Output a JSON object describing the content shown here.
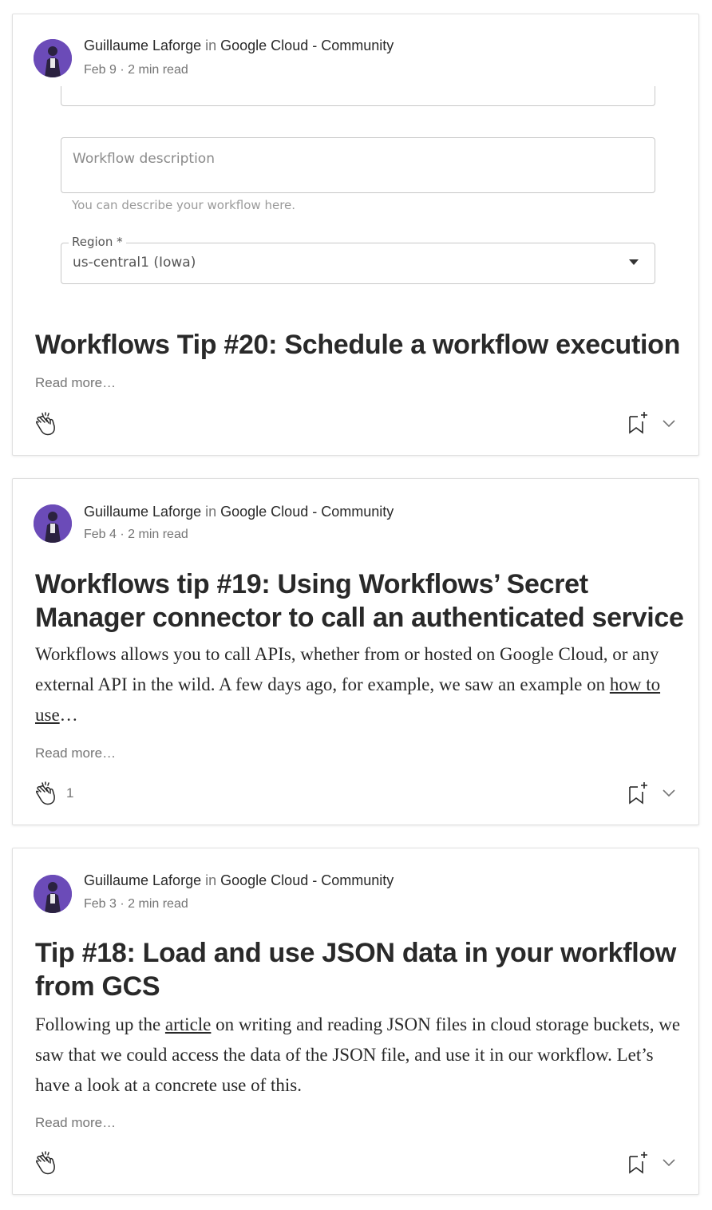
{
  "posts": [
    {
      "author": "Guillaume Laforge",
      "in_word": "in",
      "publication": "Google Cloud - Community",
      "date": "Feb 9",
      "read_time": "2 min read",
      "title": "Workflows Tip #20: Schedule a workflow execution",
      "excerpt": "",
      "read_more": "Read more…",
      "claps": "",
      "image": {
        "description_placeholder": "Workflow description",
        "description_helper": "You can describe your workflow here.",
        "region_label": "Region *",
        "region_value": "us-central1 (Iowa)"
      }
    },
    {
      "author": "Guillaume Laforge",
      "in_word": "in",
      "publication": "Google Cloud - Community",
      "date": "Feb 4",
      "read_time": "2 min read",
      "title": "Workflows tip #19: Using Workflows’ Secret Manager connector to call an authenticated service",
      "excerpt_before": "Workflows allows you to call APIs, whether from or hosted on Google Cloud, or any external API in the wild. A few days ago, for example, we saw an example on ",
      "excerpt_link": "how to use",
      "excerpt_after": "…",
      "read_more": "Read more…",
      "claps": "1"
    },
    {
      "author": "Guillaume Laforge",
      "in_word": "in",
      "publication": "Google Cloud - Community",
      "date": "Feb 3",
      "read_time": "2 min read",
      "title": "Tip #18: Load and use JSON data in your workflow from GCS",
      "excerpt_before": "Following up the ",
      "excerpt_link": "article",
      "excerpt_after": " on writing and reading JSON files in cloud storage buckets, we saw that we could access the data of the JSON file, and use it in our workflow. Let’s have a look at a concrete use of this.",
      "read_more": "Read more…",
      "claps": ""
    }
  ],
  "meta_separator": "·",
  "colors": {
    "text": "#292929",
    "muted": "#757575",
    "avatar": "#6b4bb8",
    "border": "#e0e0e0"
  },
  "icons": {
    "clap": "clap-icon",
    "bookmark": "bookmark-add-icon",
    "more": "chevron-down-icon"
  }
}
